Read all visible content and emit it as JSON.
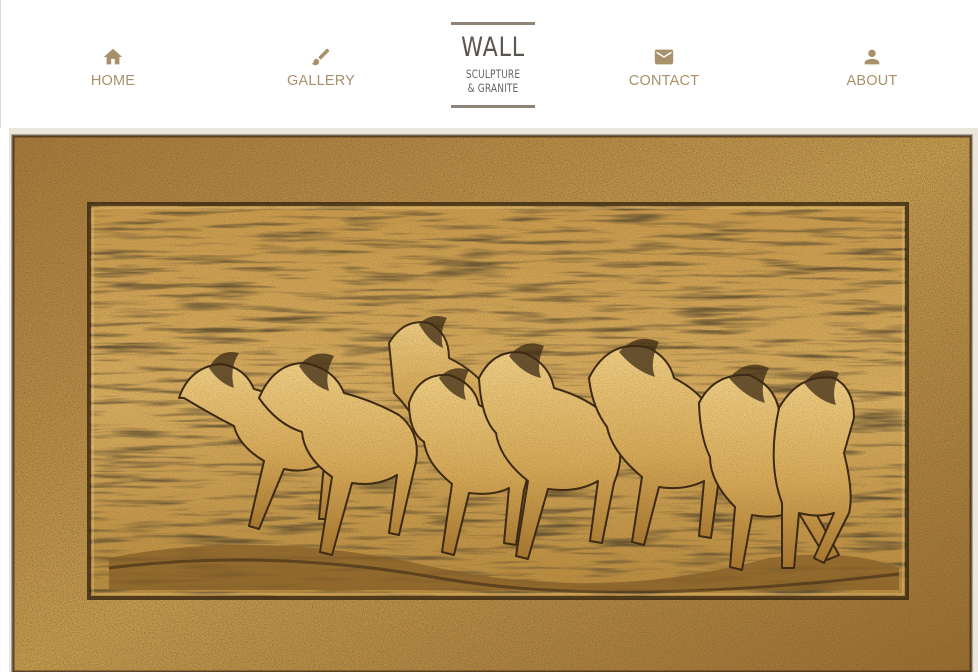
{
  "nav": {
    "items": [
      {
        "label": "HOME",
        "icon": "home-icon"
      },
      {
        "label": "GALLERY",
        "icon": "brush-icon"
      },
      {
        "label": "CONTACT",
        "icon": "envelope-icon"
      },
      {
        "label": "ABOUT",
        "icon": "person-icon"
      }
    ],
    "color": "#a8916a"
  },
  "logo": {
    "main": "WALL",
    "line1": "SCULPTURE",
    "line2": "& GRANITE"
  },
  "hero": {
    "subject": "bronze relief wall sculpture of running horses",
    "colors": {
      "bronze": "#b98a3a",
      "dark": "#3e2c16",
      "light": "#d9b46a"
    }
  }
}
